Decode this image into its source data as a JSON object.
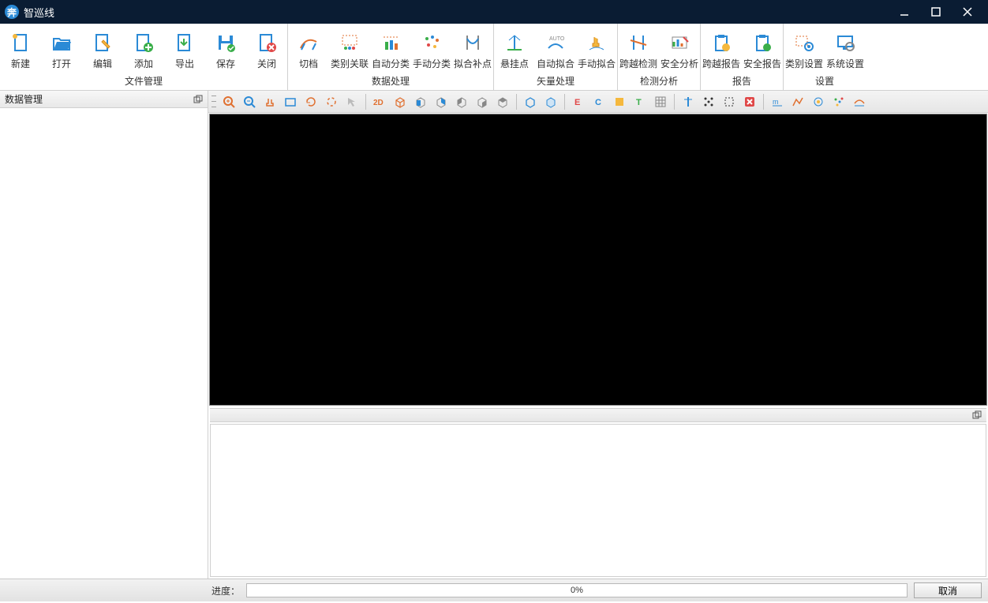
{
  "app": {
    "title": "智巡线"
  },
  "ribbon": {
    "groups": [
      {
        "label": "文件管理",
        "items": [
          "新建",
          "打开",
          "编辑",
          "添加",
          "导出",
          "保存",
          "关闭"
        ]
      },
      {
        "label": "数据处理",
        "items": [
          "切档",
          "类别关联",
          "自动分类",
          "手动分类",
          "拟合补点"
        ]
      },
      {
        "label": "矢量处理",
        "items": [
          "悬挂点",
          "自动拟合",
          "手动拟合"
        ]
      },
      {
        "label": "检测分析",
        "items": [
          "跨越检测",
          "安全分析"
        ]
      },
      {
        "label": "报告",
        "items": [
          "跨越报告",
          "安全报告"
        ]
      },
      {
        "label": "设置",
        "items": [
          "类别设置",
          "系统设置"
        ]
      }
    ]
  },
  "panel": {
    "title": "数据管理"
  },
  "status": {
    "label": "进度：",
    "percent": "0%",
    "cancel": "取消"
  },
  "toolbar_icons": [
    "zoom-in",
    "zoom-out",
    "pan",
    "extent",
    "refresh",
    "rotate",
    "select",
    "sep",
    "view-2d",
    "cube-persp",
    "cube-front",
    "cube-back",
    "cube-left",
    "cube-right",
    "cube-top",
    "sep",
    "box-a",
    "box-b",
    "sep",
    "elev-e",
    "class-c",
    "intensity-i",
    "tile-t",
    "grid",
    "sep",
    "tower",
    "points",
    "crop",
    "delete",
    "sep",
    "measure",
    "profile",
    "mark",
    "scatter",
    "curve"
  ]
}
